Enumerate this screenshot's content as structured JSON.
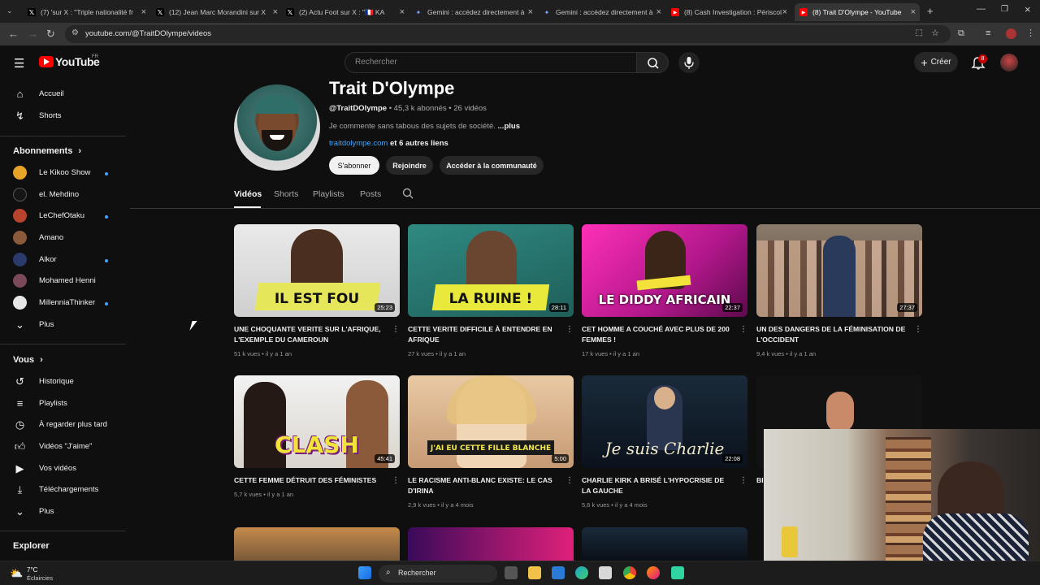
{
  "browser": {
    "tabs": [
      {
        "label": "(7) 'sur X : \"Triple nationalité fr",
        "favicon": "x-icon"
      },
      {
        "label": "(12) Jean Marc Morandini sur X",
        "favicon": "x-icon"
      },
      {
        "label": "(2) Actu Foot sur X : \"🇫🇷 KA",
        "favicon": "x-icon"
      },
      {
        "label": "Gemini : accédez directement à",
        "favicon": "gemini-icon"
      },
      {
        "label": "Gemini : accédez directement à",
        "favicon": "gemini-icon"
      },
      {
        "label": "(8) Cash Investigation : Périscol",
        "favicon": "youtube-icon"
      },
      {
        "label": "(8) Trait D'Olympe - YouTube",
        "favicon": "youtube-icon",
        "active": true
      }
    ],
    "url": "youtube.com/@TraitDOlympe/videos"
  },
  "header": {
    "logo_text": "YouTube",
    "logo_region": "FR",
    "search_placeholder": "Rechercher",
    "create_label": "Créer",
    "notification_count": "8"
  },
  "sidebar": {
    "main": [
      {
        "label": "Accueil",
        "icon": "home-icon"
      },
      {
        "label": "Shorts",
        "icon": "shorts-icon"
      }
    ],
    "subscriptions_title": "Abonnements",
    "subscriptions": [
      {
        "label": "Le Kikoo Show",
        "dot": true
      },
      {
        "label": "el. Mehdino",
        "dot": false
      },
      {
        "label": "LeChefOtaku",
        "dot": true
      },
      {
        "label": "Amano",
        "dot": false
      },
      {
        "label": "Alkor",
        "dot": true
      },
      {
        "label": "Mohamed Henni",
        "dot": false
      },
      {
        "label": "MillenniaThinker",
        "dot": true
      }
    ],
    "subscriptions_more": "Plus",
    "you_title": "Vous",
    "you_items": [
      {
        "label": "Historique",
        "icon": "history-icon"
      },
      {
        "label": "Playlists",
        "icon": "playlists-icon"
      },
      {
        "label": "À regarder plus tard",
        "icon": "watch-later-icon"
      },
      {
        "label": "Vidéos \"J'aime\"",
        "icon": "like-icon"
      },
      {
        "label": "Vos vidéos",
        "icon": "your-videos-icon"
      },
      {
        "label": "Téléchargements",
        "icon": "download-icon"
      }
    ],
    "you_more": "Plus",
    "explore_title": "Explorer"
  },
  "channel": {
    "name": "Trait D'Olympe",
    "handle": "@TraitDOlympe",
    "subscribers": "45,3 k abonnés",
    "video_count": "26 vidéos",
    "description": "Je commente sans tabous des sujets de société.",
    "description_more": "...plus",
    "link": "traitdolympe.com",
    "link_more": "et 6 autres liens",
    "subscribe_label": "S'abonner",
    "join_label": "Rejoindre",
    "community_label": "Accéder à la communauté"
  },
  "tabs": [
    "Vidéos",
    "Shorts",
    "Playlists",
    "Posts"
  ],
  "videos": [
    {
      "title": "UNE CHOQUANTE VERITE SUR L'AFRIQUE, L'EXEMPLE DU CAMEROUN",
      "meta": "51 k vues • il y a 1 an",
      "duration": "25:23",
      "thumb_text": "IL EST FOU",
      "thumb_color": "#e6e65a"
    },
    {
      "title": "CETTE VERITE DIFFICILE À ENTENDRE EN AFRIQUE",
      "meta": "27 k vues • il y a 1 an",
      "duration": "28:11",
      "thumb_text": "LA RUINE !",
      "thumb_color": "#e9e93c"
    },
    {
      "title": "CET HOMME A COUCHÉ AVEC PLUS DE 200 FEMMES !",
      "meta": "17 k vues • il y a 1 an",
      "duration": "22:37",
      "thumb_text": "LE DIDDY AFRICAIN",
      "thumb_color": "#ffffff"
    },
    {
      "title": "UN DES DANGERS DE LA FÉMINISATION DE L'OCCIDENT",
      "meta": "9,4 k vues • il y a 1 an",
      "duration": "27:37",
      "thumb_text": "",
      "thumb_color": "#ffffff"
    },
    {
      "title": "CETTE FEMME DÉTRUIT DES FÉMINISTES",
      "meta": "5,7 k vues • il y a 1 an",
      "duration": "45:41",
      "thumb_text": "CLASH",
      "thumb_color": "#f0e43a"
    },
    {
      "title": "LE RACISME ANTI-BLANC EXISTE: LE CAS D'IRINA",
      "meta": "2,9 k vues • il y a 4 mois",
      "duration": "5:00",
      "thumb_text": "J'AI EU CETTE FILLE BLANCHE",
      "thumb_color": "#f2e84a"
    },
    {
      "title": "CHARLIE KIRK A BRISÉ L'HYPOCRISIE DE LA GAUCHE",
      "meta": "5,6 k vues • il y a 4 mois",
      "duration": "22:08",
      "thumb_text": "Je suis Charlie",
      "thumb_color": "#f0e8c8"
    },
    {
      "title": "BI...",
      "meta": "",
      "duration": "",
      "thumb_text": "",
      "thumb_color": "#ffffff"
    }
  ],
  "taskbar": {
    "temperature": "7°C",
    "condition": "Éclaircies",
    "search_label": "Rechercher"
  }
}
